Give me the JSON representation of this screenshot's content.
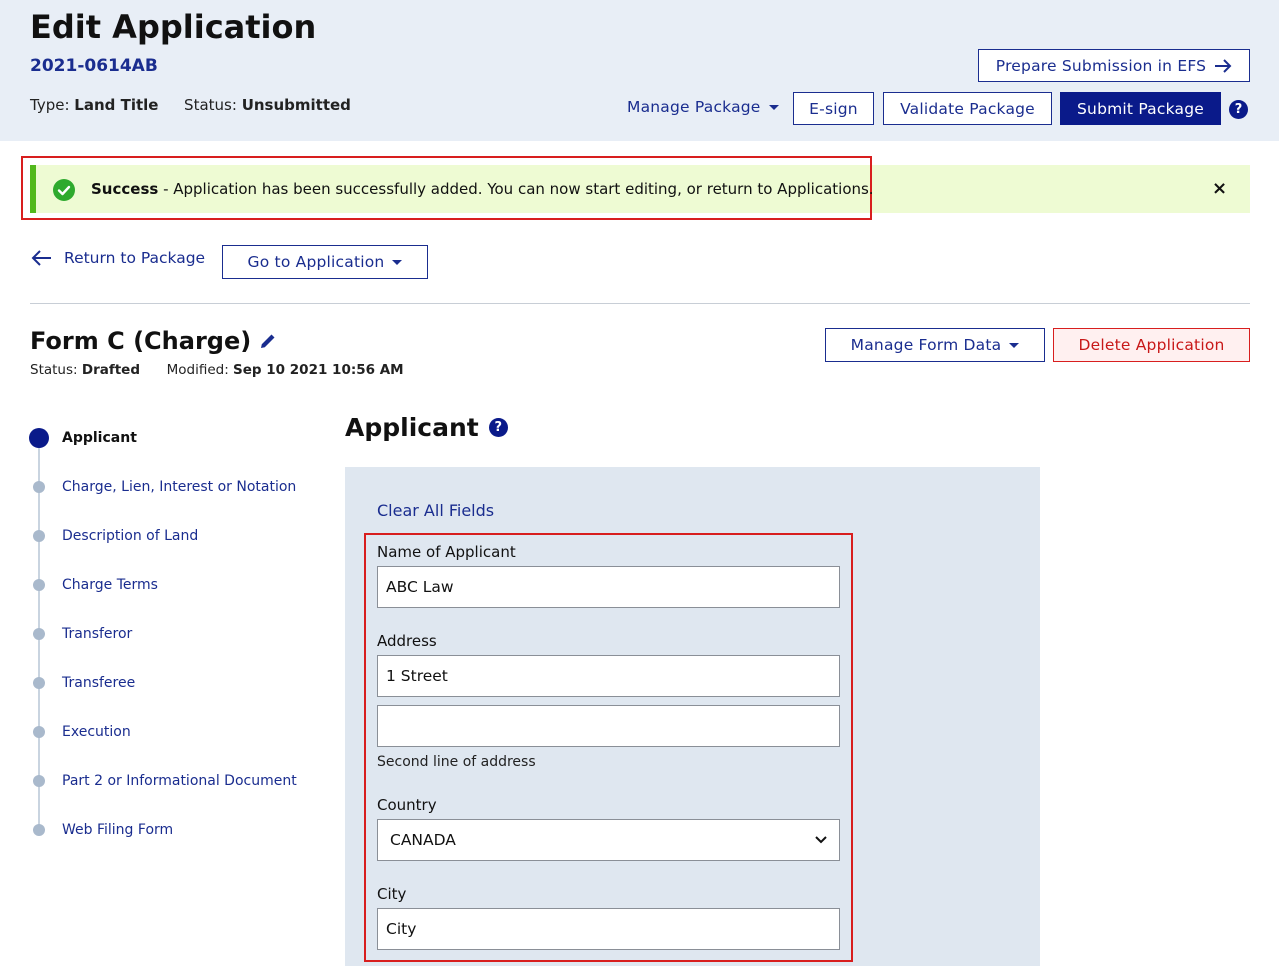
{
  "header": {
    "title": "Edit Application",
    "code": "2021-0614AB",
    "type_label": "Type:",
    "type_value": "Land Title",
    "status_label": "Status:",
    "status_value": "Unsubmitted",
    "prepare_submission": "Prepare Submission in EFS",
    "manage_package": "Manage Package",
    "esign": "E-sign",
    "validate_package": "Validate Package",
    "submit_package": "Submit Package",
    "help": "?"
  },
  "alert": {
    "bold": "Success",
    "message": " - Application has been successfully added. You can now start editing, or return to Applications.",
    "close": "×"
  },
  "nav": {
    "return_to_package": "Return to Package",
    "go_to_application": "Go to Application"
  },
  "form": {
    "title": "Form C (Charge)",
    "status_label": "Status:",
    "status_value": "Drafted",
    "modified_label": "Modified:",
    "modified_value": "Sep 10 2021 10:56 AM",
    "manage_form_data": "Manage Form Data",
    "delete_application": "Delete Application"
  },
  "steps": [
    {
      "label": "Applicant",
      "active": true
    },
    {
      "label": "Charge, Lien, Interest or Notation"
    },
    {
      "label": "Description of Land"
    },
    {
      "label": "Charge Terms"
    },
    {
      "label": "Transferor"
    },
    {
      "label": "Transferee"
    },
    {
      "label": "Execution"
    },
    {
      "label": "Part 2 or Informational Document"
    },
    {
      "label": "Web Filing Form"
    }
  ],
  "section": {
    "title": "Applicant",
    "help": "?",
    "clear_all": "Clear All Fields",
    "name_label": "Name of Applicant",
    "name_value": "ABC Law",
    "address_label": "Address",
    "address_line1": "1 Street",
    "address_line2": "",
    "address_hint": "Second line of address",
    "country_label": "Country",
    "country_value": "CANADA",
    "city_label": "City",
    "city_value": "City"
  },
  "colors": {
    "primary": "#0a1a8a",
    "header_bg": "#e8eef6",
    "success_bg": "#eefbd3",
    "success_bar": "#52b81c",
    "danger": "#d81e1e",
    "panel_bg": "#dfe7f0"
  },
  "icons": [
    "arrow-right-icon",
    "caret-down-icon",
    "help-icon",
    "check-circle-icon",
    "close-icon",
    "arrow-left-icon",
    "pencil-icon",
    "chevron-down-icon"
  ]
}
